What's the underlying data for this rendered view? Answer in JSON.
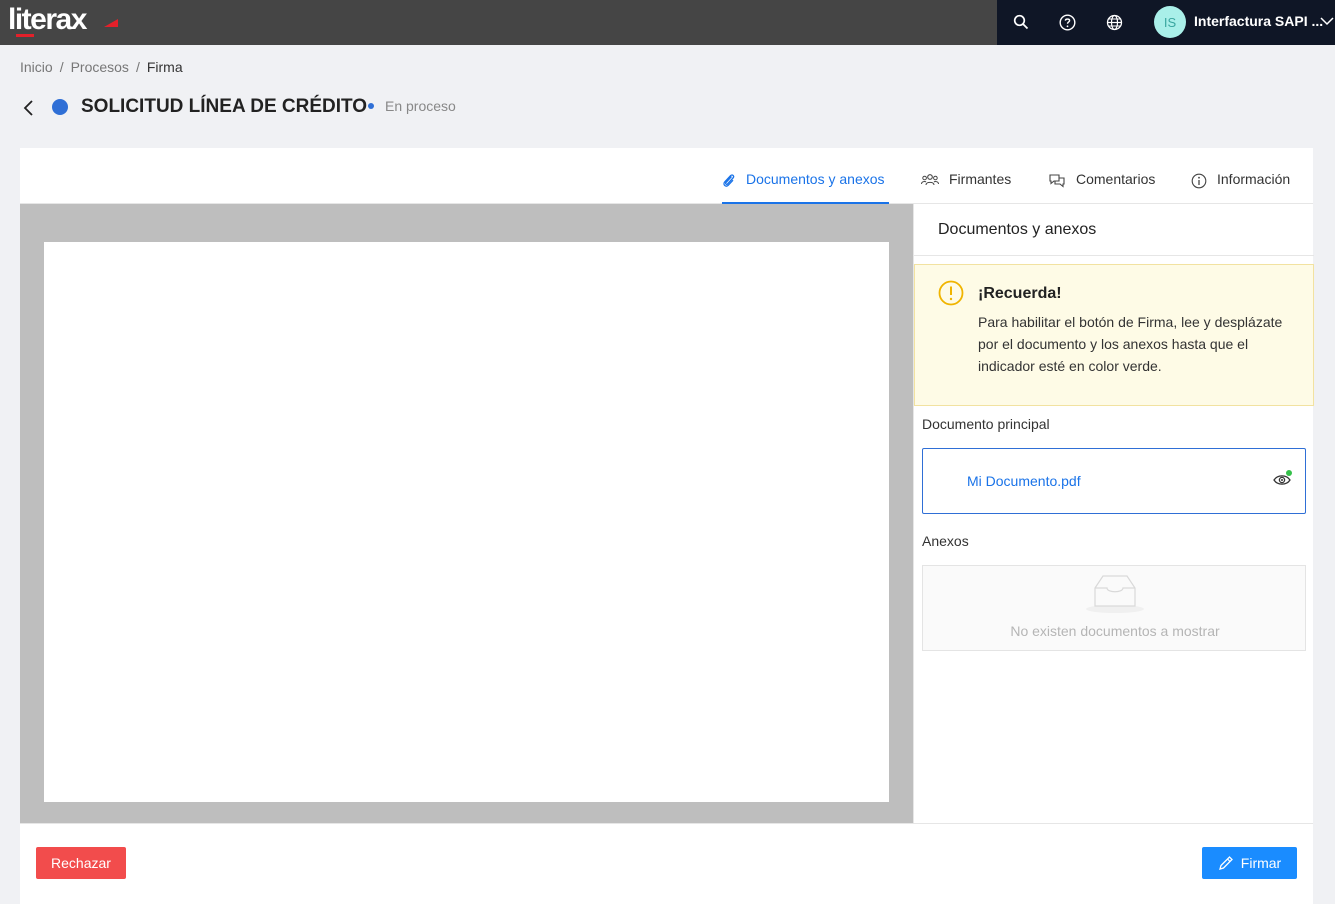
{
  "app": {
    "logo": "literax",
    "user_initials": "IS",
    "user_name": "Interfactura SAPI ...",
    "accent": "#1a73e8",
    "brand_red": "#e3202a"
  },
  "topbar": {
    "icons": [
      "search-icon",
      "help-icon",
      "globe-icon",
      "chevron-down-icon"
    ]
  },
  "breadcrumb": {
    "items": [
      "Inicio",
      "Procesos",
      "Firma"
    ],
    "separator": "/"
  },
  "header": {
    "title": "SOLICITUD LÍNEA DE CRÉDITO",
    "status": "En proceso",
    "status_color": "#2f6fd6"
  },
  "tabs": [
    {
      "label": "Documentos y anexos",
      "icon": "paperclip-icon",
      "active": true
    },
    {
      "label": "Firmantes",
      "icon": "users-icon",
      "active": false
    },
    {
      "label": "Comentarios",
      "icon": "chat-icon",
      "active": false
    },
    {
      "label": "Información",
      "icon": "info-icon",
      "active": false
    }
  ],
  "panel": {
    "title": "Documentos y anexos",
    "alert": {
      "title": "¡Recuerda!",
      "text": "Para habilitar el botón de Firma, lee y desplázate por el documento y los anexos hasta que el indicador esté en color verde.",
      "color": "#f0b400"
    },
    "main_doc_label": "Documento principal",
    "main_doc_name": "Mi Documento.pdf",
    "read_indicator_color": "#35c04a",
    "annex_label": "Anexos",
    "annex_empty": "No existen documentos a mostrar"
  },
  "footer": {
    "reject_label": "Rechazar",
    "sign_label": "Firmar",
    "reject_color": "#f24c4c",
    "sign_color": "#1a8cff"
  }
}
